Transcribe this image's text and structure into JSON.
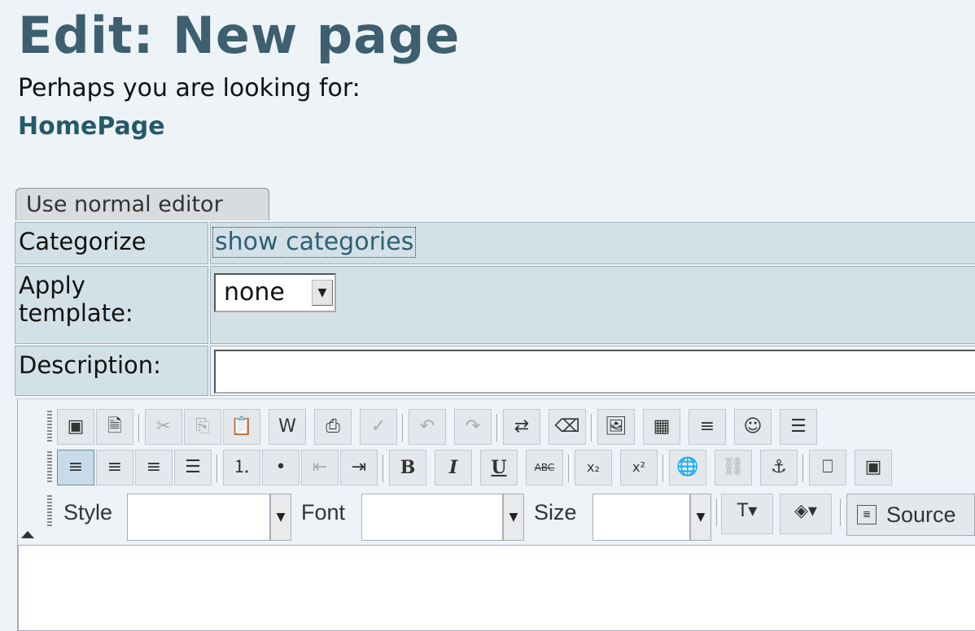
{
  "page": {
    "title": "Edit: New page",
    "looking_for": "Perhaps you are looking for:",
    "suggestion": "HomePage"
  },
  "tab": {
    "label": "Use normal editor"
  },
  "form": {
    "categorize_label": "Categorize",
    "show_categories": "show categories",
    "template_label": "Apply template:",
    "template_value": "none",
    "description_label": "Description:",
    "description_value": ""
  },
  "toolbar": {
    "style_label": "Style",
    "font_label": "Font",
    "size_label": "Size",
    "source_label": "Source",
    "bold": "B",
    "italic": "I",
    "underline": "U",
    "strike": "ABC",
    "subscript": "x₂",
    "superscript": "x²"
  },
  "colors": {
    "title": "#3d5f6f",
    "link": "#245a69",
    "form_bg": "#d3e0e7"
  }
}
